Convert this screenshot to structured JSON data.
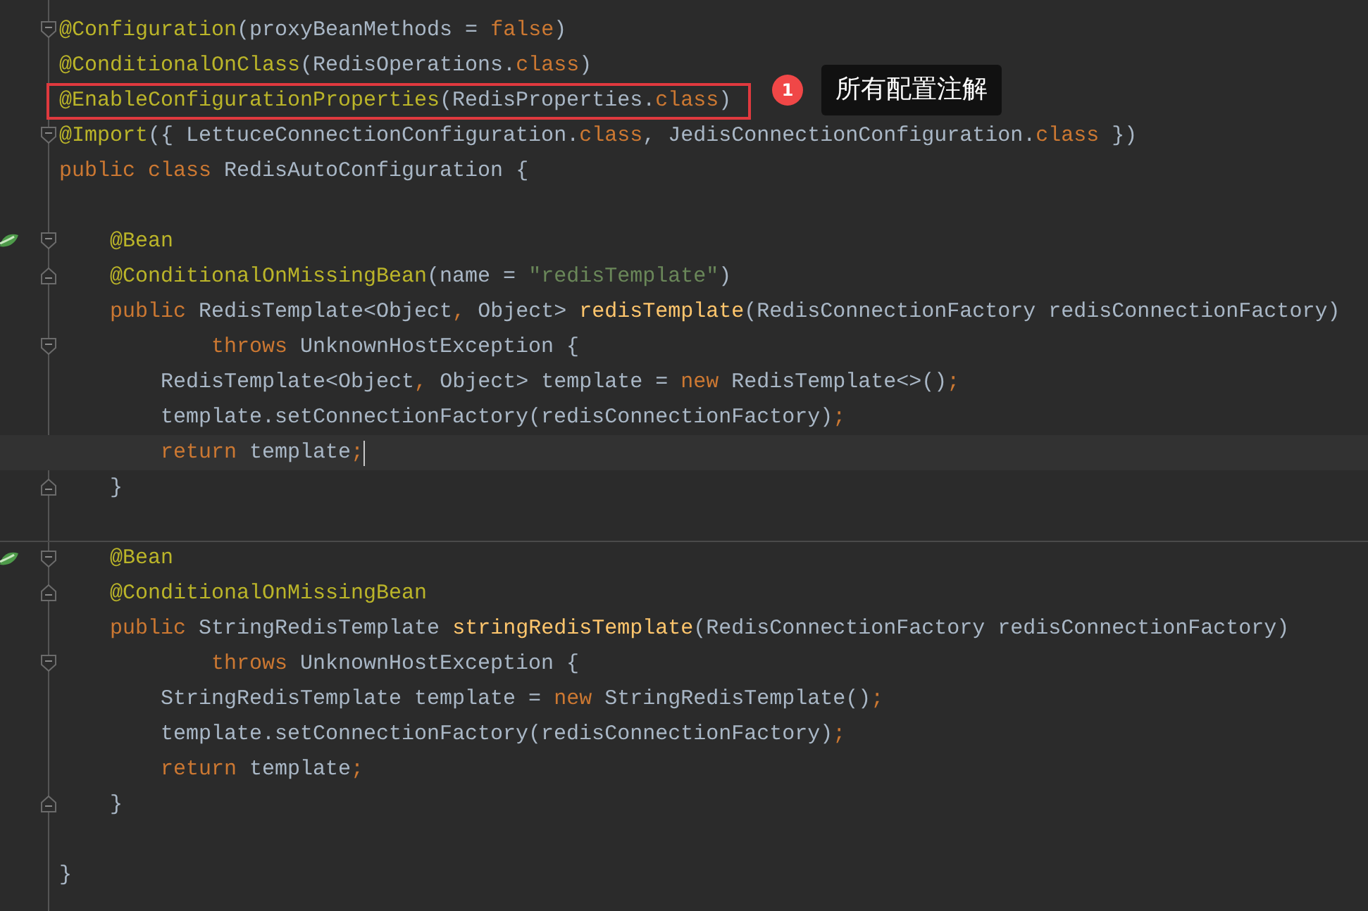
{
  "editor": {
    "lines": [
      {
        "kind": "code",
        "fold_start": true,
        "tokens": [
          {
            "kind": "annotation",
            "s": "@Configuration"
          },
          {
            "kind": "plain",
            "s": "(proxyBeanMethods = "
          },
          {
            "kind": "keyword",
            "s": "false"
          },
          {
            "kind": "plain",
            "s": ")"
          }
        ]
      },
      {
        "kind": "code",
        "tokens": [
          {
            "kind": "annotation",
            "s": "@ConditionalOnClass"
          },
          {
            "kind": "plain",
            "s": "(RedisOperations."
          },
          {
            "kind": "keyword",
            "s": "class"
          },
          {
            "kind": "plain",
            "s": ")"
          }
        ]
      },
      {
        "kind": "code",
        "boxed": true,
        "callout": {
          "number": "1",
          "text": "所有配置注解"
        },
        "tokens": [
          {
            "kind": "annotation",
            "s": "@EnableConfigurationProperties"
          },
          {
            "kind": "plain",
            "s": "(RedisProperties."
          },
          {
            "kind": "keyword",
            "s": "class"
          },
          {
            "kind": "plain",
            "s": ")"
          }
        ]
      },
      {
        "kind": "code",
        "fold_start": true,
        "tokens": [
          {
            "kind": "annotation",
            "s": "@Import"
          },
          {
            "kind": "plain",
            "s": "({ LettuceConnectionConfiguration."
          },
          {
            "kind": "keyword",
            "s": "class"
          },
          {
            "kind": "plain",
            "s": ", JedisConnectionConfiguration."
          },
          {
            "kind": "keyword",
            "s": "class"
          },
          {
            "kind": "plain",
            "s": " })"
          }
        ]
      },
      {
        "kind": "code",
        "tokens": [
          {
            "kind": "keyword",
            "s": "public class "
          },
          {
            "kind": "plain",
            "s": "RedisAutoConfiguration {"
          }
        ]
      },
      {
        "kind": "blank"
      },
      {
        "kind": "code",
        "bean": true,
        "fold_start": true,
        "tokens": [
          {
            "kind": "annotation",
            "s": "    @Bean"
          }
        ]
      },
      {
        "kind": "code",
        "fold_end": true,
        "tokens": [
          {
            "kind": "annotation",
            "s": "    @ConditionalOnMissingBean"
          },
          {
            "kind": "plain",
            "s": "(name = "
          },
          {
            "kind": "string",
            "s": "\"redisTemplate\""
          },
          {
            "kind": "plain",
            "s": ")"
          }
        ]
      },
      {
        "kind": "code",
        "tokens": [
          {
            "kind": "keyword",
            "s": "    public "
          },
          {
            "kind": "plain",
            "s": "RedisTemplate<Object"
          },
          {
            "kind": "keyword",
            "s": ", "
          },
          {
            "kind": "plain",
            "s": "Object> "
          },
          {
            "kind": "method",
            "s": "redisTemplate"
          },
          {
            "kind": "plain",
            "s": "(RedisConnectionFactory redisConnectionFactory)"
          }
        ]
      },
      {
        "kind": "code",
        "fold_start": true,
        "tokens": [
          {
            "kind": "keyword",
            "s": "            throws "
          },
          {
            "kind": "plain",
            "s": "UnknownHostException {"
          }
        ]
      },
      {
        "kind": "code",
        "tokens": [
          {
            "kind": "plain",
            "s": "        RedisTemplate<Object"
          },
          {
            "kind": "keyword",
            "s": ", "
          },
          {
            "kind": "plain",
            "s": "Object> template = "
          },
          {
            "kind": "keyword",
            "s": "new "
          },
          {
            "kind": "plain",
            "s": "RedisTemplate<>()"
          },
          {
            "kind": "keyword",
            "s": ";"
          }
        ]
      },
      {
        "kind": "code",
        "tokens": [
          {
            "kind": "plain",
            "s": "        template.setConnectionFactory(redisConnectionFactory)"
          },
          {
            "kind": "keyword",
            "s": ";"
          }
        ]
      },
      {
        "kind": "code",
        "current": true,
        "tokens": [
          {
            "kind": "keyword",
            "s": "        return "
          },
          {
            "kind": "plain",
            "s": "template"
          },
          {
            "kind": "keyword",
            "s": ";"
          }
        ]
      },
      {
        "kind": "code",
        "fold_end": true,
        "tokens": [
          {
            "kind": "plain",
            "s": "    }"
          }
        ]
      },
      {
        "kind": "blank"
      },
      {
        "kind": "code",
        "separator": true,
        "bean": true,
        "fold_start": true,
        "tokens": [
          {
            "kind": "annotation",
            "s": "    @Bean"
          }
        ]
      },
      {
        "kind": "code",
        "fold_end": true,
        "tokens": [
          {
            "kind": "annotation",
            "s": "    @ConditionalOnMissingBean"
          }
        ]
      },
      {
        "kind": "code",
        "tokens": [
          {
            "kind": "keyword",
            "s": "    public "
          },
          {
            "kind": "plain",
            "s": "StringRedisTemplate "
          },
          {
            "kind": "method",
            "s": "stringRedisTemplate"
          },
          {
            "kind": "plain",
            "s": "(RedisConnectionFactory redisConnectionFactory)"
          }
        ]
      },
      {
        "kind": "code",
        "fold_start": true,
        "tokens": [
          {
            "kind": "keyword",
            "s": "            throws "
          },
          {
            "kind": "plain",
            "s": "UnknownHostException {"
          }
        ]
      },
      {
        "kind": "code",
        "tokens": [
          {
            "kind": "plain",
            "s": "        StringRedisTemplate template = "
          },
          {
            "kind": "keyword",
            "s": "new "
          },
          {
            "kind": "plain",
            "s": "StringRedisTemplate()"
          },
          {
            "kind": "keyword",
            "s": ";"
          }
        ]
      },
      {
        "kind": "code",
        "tokens": [
          {
            "kind": "plain",
            "s": "        template.setConnectionFactory(redisConnectionFactory)"
          },
          {
            "kind": "keyword",
            "s": ";"
          }
        ]
      },
      {
        "kind": "code",
        "tokens": [
          {
            "kind": "keyword",
            "s": "        return "
          },
          {
            "kind": "plain",
            "s": "template"
          },
          {
            "kind": "keyword",
            "s": ";"
          }
        ]
      },
      {
        "kind": "code",
        "fold_end": true,
        "tokens": [
          {
            "kind": "plain",
            "s": "    }"
          }
        ]
      },
      {
        "kind": "blank"
      },
      {
        "kind": "code",
        "tokens": [
          {
            "kind": "plain",
            "s": "}"
          }
        ]
      }
    ]
  }
}
